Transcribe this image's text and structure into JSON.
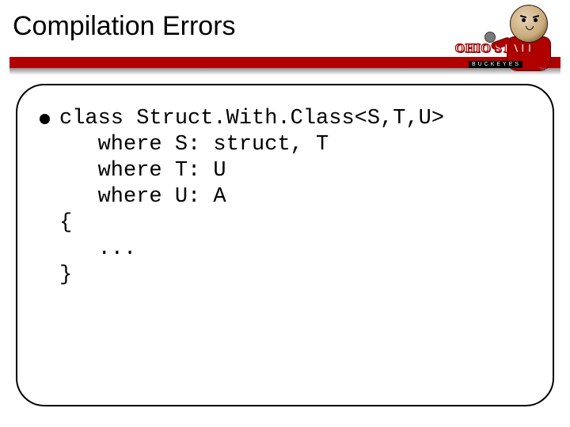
{
  "title": "Compilation Errors",
  "logo": {
    "line1": "OHIO STATE",
    "line2": "BUCKEYES",
    "tm": "TM"
  },
  "code": {
    "l1": "class Struct.With.Class<S,T,U>",
    "l2": "   where S: struct, T",
    "l3": "   where T: U",
    "l4": "   where U: A",
    "l5": "{",
    "l6": "   ...",
    "l7": "}"
  }
}
